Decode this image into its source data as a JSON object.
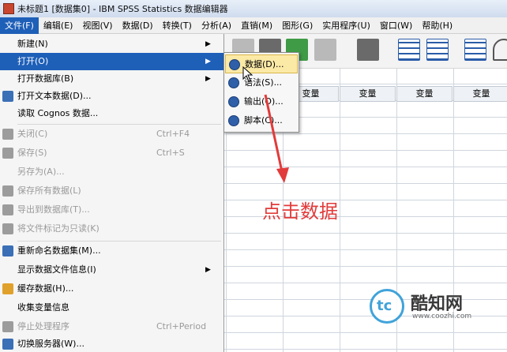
{
  "window": {
    "title": "未标题1 [数据集0] - IBM SPSS Statistics 数据编辑器"
  },
  "menubar": [
    {
      "label": "文件(F)"
    },
    {
      "label": "编辑(E)"
    },
    {
      "label": "视图(V)"
    },
    {
      "label": "数据(D)"
    },
    {
      "label": "转换(T)"
    },
    {
      "label": "分析(A)"
    },
    {
      "label": "直销(M)"
    },
    {
      "label": "图形(G)"
    },
    {
      "label": "实用程序(U)"
    },
    {
      "label": "窗口(W)"
    },
    {
      "label": "帮助(H)"
    }
  ],
  "file_menu": [
    {
      "label": "新建(N)",
      "submenu": true
    },
    {
      "label": "打开(O)",
      "submenu": true
    },
    {
      "label": "打开数据库(B)",
      "submenu": true
    },
    {
      "label": "打开文本数据(D)...",
      "icon": "text-data-icon"
    },
    {
      "label": "读取 Cognos 数据..."
    },
    {
      "label": "关闭(C)",
      "shortcut": "Ctrl+F4",
      "disabled": true,
      "icon": "close-icon"
    },
    {
      "label": "保存(S)",
      "shortcut": "Ctrl+S",
      "disabled": true,
      "icon": "save-icon"
    },
    {
      "label": "另存为(A)...",
      "disabled": true
    },
    {
      "label": "保存所有数据(L)",
      "disabled": true,
      "icon": "save-all-icon"
    },
    {
      "label": "导出到数据库(T)...",
      "disabled": true,
      "icon": "export-db-icon"
    },
    {
      "label": "将文件标记为只读(K)",
      "disabled": true,
      "icon": "readonly-icon"
    },
    {
      "label": "重新命名数据集(M)...",
      "icon": "rename-icon"
    },
    {
      "label": "显示数据文件信息(I)",
      "submenu": true
    },
    {
      "label": "缓存数据(H)...",
      "icon": "cache-icon"
    },
    {
      "label": "收集变量信息"
    },
    {
      "label": "停止处理程序",
      "shortcut": "Ctrl+Period",
      "disabled": true,
      "icon": "stop-icon"
    },
    {
      "label": "切换服务器(W)...",
      "icon": "server-icon"
    }
  ],
  "open_submenu": [
    {
      "label": "数据(D)...",
      "highlighted": true
    },
    {
      "label": "语法(S)..."
    },
    {
      "label": "输出(O)..."
    },
    {
      "label": "脚本(C)..."
    }
  ],
  "grid": {
    "column_headers": [
      "变量",
      "变量",
      "变量",
      "变量"
    ]
  },
  "annotation": {
    "text": "点击数据",
    "color": "#e23b3b"
  },
  "watermark": {
    "logo_text": "tc",
    "brand": "酷知网",
    "url": "www.coozhi.com"
  },
  "colors": {
    "menu_highlight": "#1e5fb8",
    "submenu_highlight": "#fbe9a6"
  }
}
